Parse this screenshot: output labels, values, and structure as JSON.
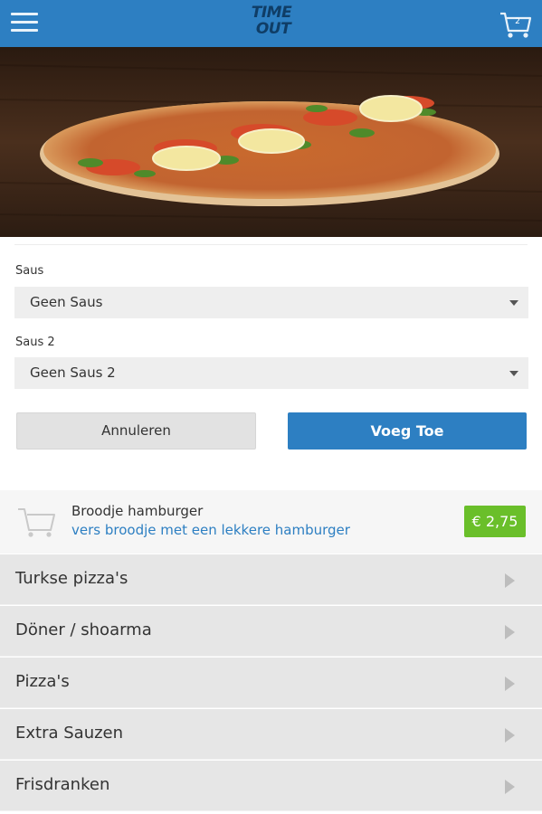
{
  "header": {
    "logo_line1": "TIME",
    "logo_line2": "OUT",
    "cart_count": "2",
    "menu_icon": "hamburger-menu-icon",
    "cart_icon": "shopping-cart-icon",
    "color": "#2d7fc2"
  },
  "hero": {
    "image": "turkse-pizza-photo"
  },
  "form": {
    "saus_label": "Saus",
    "saus_value": "Geen Saus",
    "saus2_label": "Saus 2",
    "saus2_value": "Geen Saus 2",
    "cancel_label": "Annuleren",
    "add_label": "Voeg Toe"
  },
  "product": {
    "name": "Broodje hamburger",
    "description": "vers broodje met een lekkere hamburger",
    "price": "€ 2,75",
    "price_color": "#6abf2a",
    "icon": "shopping-cart-icon"
  },
  "categories": [
    {
      "label": "Turkse pizza's"
    },
    {
      "label": "Döner / shoarma"
    },
    {
      "label": "Pizza's"
    },
    {
      "label": "Extra Sauzen"
    },
    {
      "label": "Frisdranken"
    }
  ]
}
